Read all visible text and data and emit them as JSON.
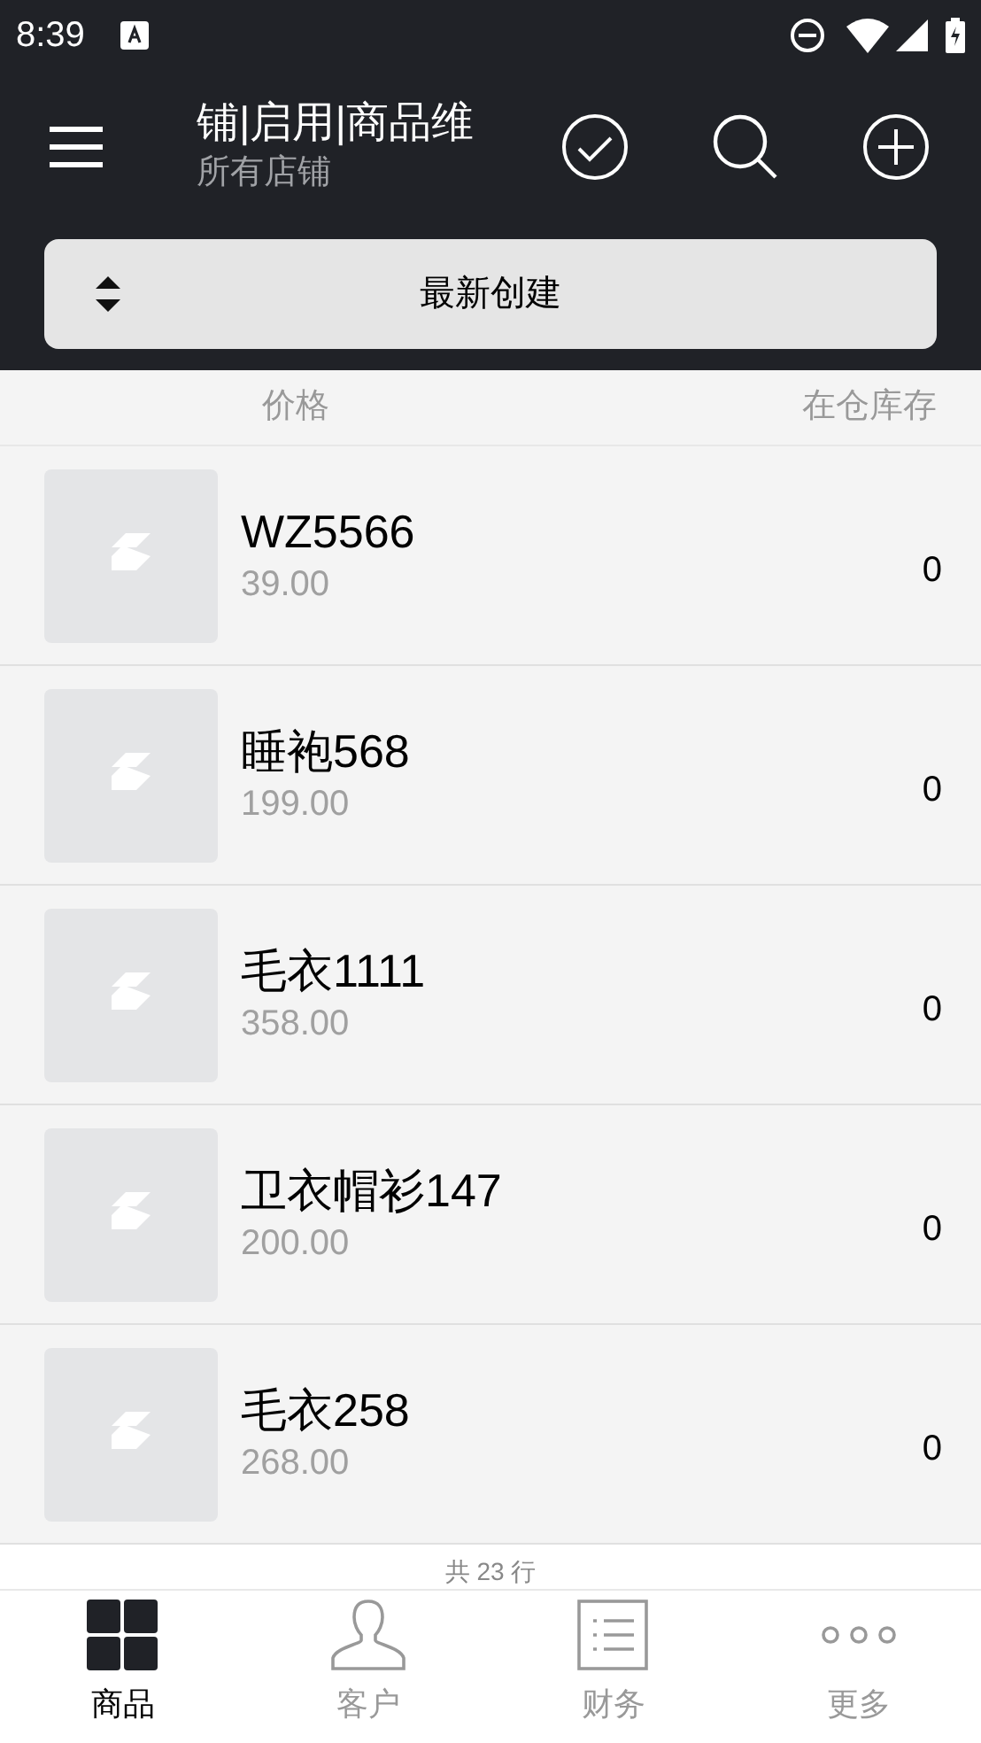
{
  "status_bar": {
    "time": "8:39"
  },
  "toolbar": {
    "title": "铺|启用|商品维",
    "subtitle": "所有店铺"
  },
  "sort_button": {
    "label": "最新创建"
  },
  "columns": [
    "价格",
    "在仓库存"
  ],
  "products": [
    {
      "name": "WZ5566",
      "price": "39.00",
      "stock": "0"
    },
    {
      "name": "睡袍568",
      "price": "199.00",
      "stock": "0"
    },
    {
      "name": "毛衣1111",
      "price": "358.00",
      "stock": "0"
    },
    {
      "name": "卫衣帽衫147",
      "price": "200.00",
      "stock": "0"
    },
    {
      "name": "毛衣258",
      "price": "268.00",
      "stock": "0"
    }
  ],
  "row_count": "共 23 行",
  "bottom_nav": [
    {
      "kind": "grid",
      "label": "商品",
      "selected": true
    },
    {
      "kind": "person",
      "label": "客户",
      "selected": false
    },
    {
      "kind": "list",
      "label": "财务",
      "selected": false
    },
    {
      "kind": "more",
      "label": "更多",
      "selected": false
    }
  ]
}
